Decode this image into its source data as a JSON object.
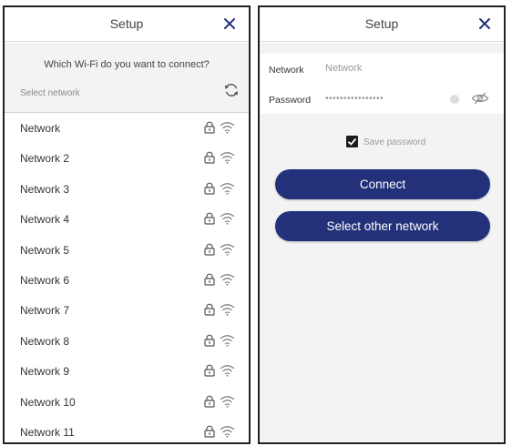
{
  "colors": {
    "accent": "#22317a",
    "background_gray": "#f3f3f3"
  },
  "left_screen": {
    "header": {
      "title": "Setup",
      "close_icon": "close-icon"
    },
    "question": "Which Wi-Fi do you want to connect?",
    "select_network_label": "Select network",
    "refresh_icon": "refresh-icon",
    "networks": [
      {
        "name": "Network"
      },
      {
        "name": "Network 2"
      },
      {
        "name": "Network 3"
      },
      {
        "name": "Network 4"
      },
      {
        "name": "Network 5"
      },
      {
        "name": "Network 6"
      },
      {
        "name": "Network 7"
      },
      {
        "name": "Network 8"
      },
      {
        "name": "Network 9"
      },
      {
        "name": "Network 10"
      },
      {
        "name": "Network 11"
      }
    ]
  },
  "right_screen": {
    "header": {
      "title": "Setup",
      "close_icon": "close-icon"
    },
    "network_label": "Network",
    "network_placeholder": "Network",
    "password_label": "Password",
    "password_mask": "••••••••••••••••",
    "save_password_label": "Save password",
    "save_password_checked": true,
    "connect_button": "Connect",
    "other_network_button": "Select other network"
  }
}
